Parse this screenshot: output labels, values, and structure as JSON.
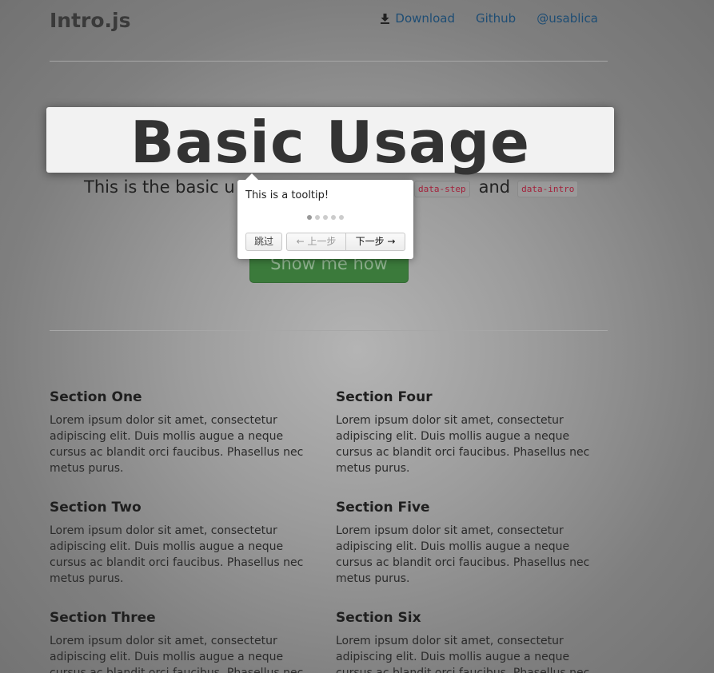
{
  "header": {
    "brand": "Intro.js",
    "nav": [
      {
        "label": "Download",
        "icon": "download-icon"
      },
      {
        "label": "Github"
      },
      {
        "label": "@usablica"
      }
    ]
  },
  "hero": {
    "title": "Basic Usage",
    "lead_prefix": "This is the basic u",
    "code1": "data-step",
    "and": "and",
    "code2": "data-intro",
    "cta_label": "Show me how"
  },
  "tooltip": {
    "text": "This is a tooltip!",
    "steps_total": 5,
    "current_step": 1,
    "skip_label": "跳过",
    "prev_label": "← 上一步",
    "next_label": "下一步 →"
  },
  "sections": [
    {
      "title": "Section One",
      "body": "Lorem ipsum dolor sit amet, consectetur adipiscing elit. Duis mollis augue a neque cursus ac blandit orci faucibus. Phasellus nec metus purus."
    },
    {
      "title": "Section Four",
      "body": "Lorem ipsum dolor sit amet, consectetur adipiscing elit. Duis mollis augue a neque cursus ac blandit orci faucibus. Phasellus nec metus purus."
    },
    {
      "title": "Section Two",
      "body": "Lorem ipsum dolor sit amet, consectetur adipiscing elit. Duis mollis augue a neque cursus ac blandit orci faucibus. Phasellus nec metus purus."
    },
    {
      "title": "Section Five",
      "body": "Lorem ipsum dolor sit amet, consectetur adipiscing elit. Duis mollis augue a neque cursus ac blandit orci faucibus. Phasellus nec metus purus."
    },
    {
      "title": "Section Three",
      "body": "Lorem ipsum dolor sit amet, consectetur adipiscing elit. Duis mollis augue a neque cursus ac blandit orci faucibus. Phasellus nec metus purus."
    },
    {
      "title": "Section Six",
      "body": "Lorem ipsum dolor sit amet, consectetur adipiscing elit. Duis mollis augue a neque cursus ac blandit orci faucibus. Phasellus nec metus purus."
    }
  ],
  "colors": {
    "link": "#1e4d74",
    "cta": "#3b7a3b",
    "code_text": "#a3213b"
  }
}
